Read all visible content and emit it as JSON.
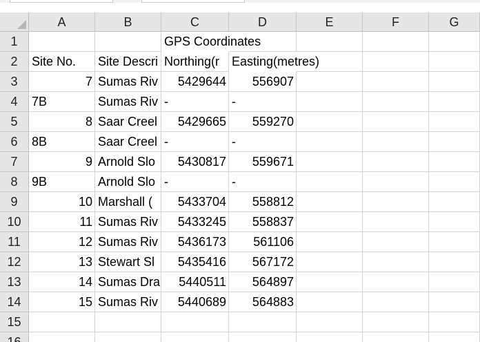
{
  "column_headers": [
    "A",
    "B",
    "C",
    "D",
    "E",
    "F",
    "G"
  ],
  "row_headers": [
    "1",
    "2",
    "3",
    "4",
    "5",
    "6",
    "7",
    "8",
    "9",
    "10",
    "11",
    "12",
    "13",
    "14",
    "15",
    "16"
  ],
  "cells": {
    "C1": "GPS Coordinates",
    "A2": "Site No.",
    "B2": "Site Descri",
    "C2": "Northing(r",
    "D2": "Easting(metres)",
    "rows": [
      {
        "site_no": "7",
        "desc": "Sumas Riv",
        "northing": "5429644",
        "easting": "556907"
      },
      {
        "site_no": "7B",
        "desc": "Sumas Riv",
        "northing": "-",
        "easting": "-"
      },
      {
        "site_no": "8",
        "desc": "Saar Creel",
        "northing": "5429665",
        "easting": "559270"
      },
      {
        "site_no": "8B",
        "desc": "Saar Creel",
        "northing": "-",
        "easting": "-"
      },
      {
        "site_no": "9",
        "desc": "Arnold Slo",
        "northing": "5430817",
        "easting": "559671"
      },
      {
        "site_no": "9B",
        "desc": "Arnold Slo",
        "northing": "-",
        "easting": "-"
      },
      {
        "site_no": "10",
        "desc": "Marshall (",
        "northing": "5433704",
        "easting": "558812"
      },
      {
        "site_no": "11",
        "desc": "Sumas Riv",
        "northing": "5433245",
        "easting": "558837"
      },
      {
        "site_no": "12",
        "desc": "Sumas Riv",
        "northing": "5436173",
        "easting": "561106"
      },
      {
        "site_no": "13",
        "desc": "Stewart Sl",
        "northing": "5435416",
        "easting": "567172"
      },
      {
        "site_no": "14",
        "desc": "Sumas Dra",
        "northing": "5440511",
        "easting": "564897"
      },
      {
        "site_no": "15",
        "desc": "Sumas Riv",
        "northing": "5440689",
        "easting": "564883"
      }
    ]
  }
}
